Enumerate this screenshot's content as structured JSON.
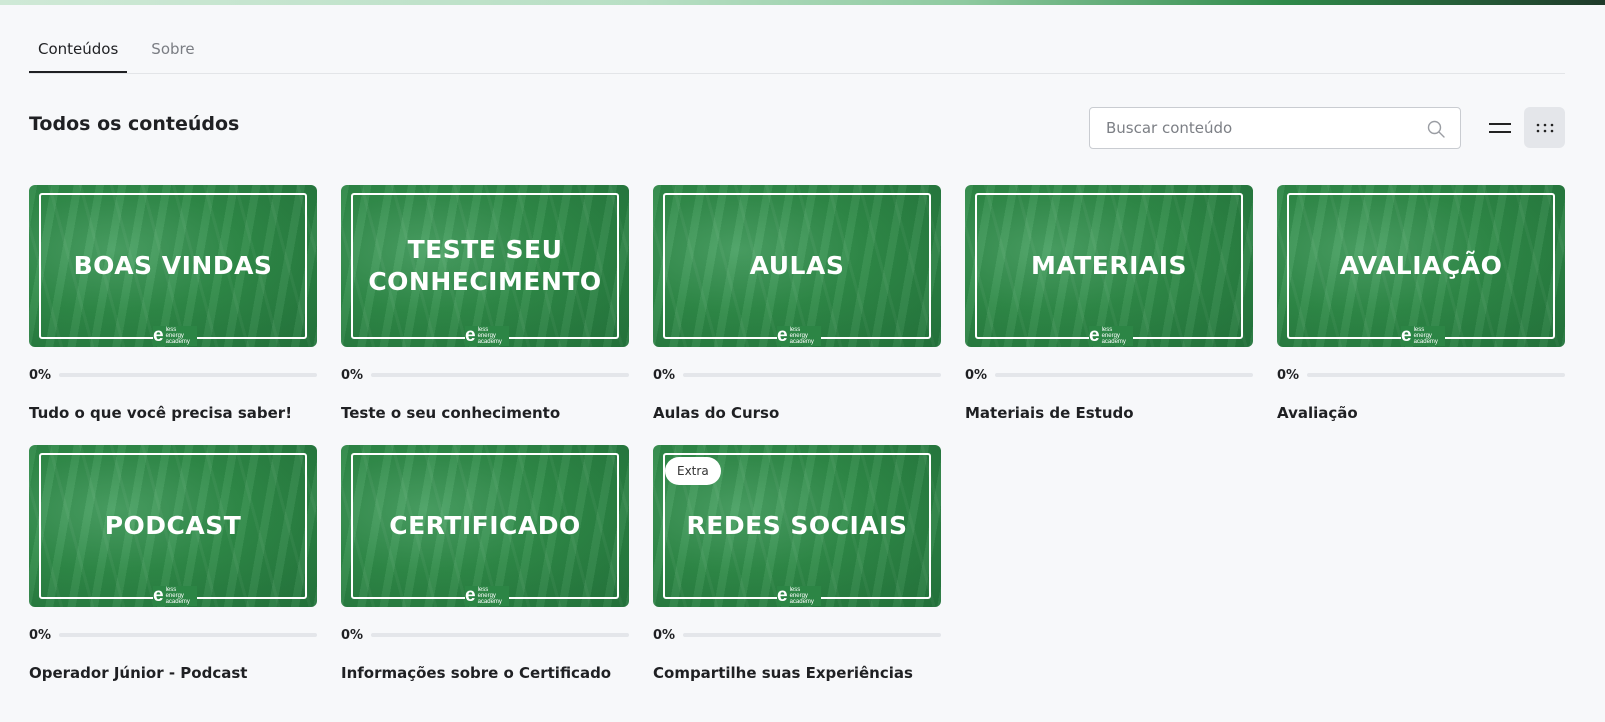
{
  "tabs": [
    {
      "label": "Conteúdos",
      "active": true
    },
    {
      "label": "Sobre",
      "active": false
    }
  ],
  "section_title": "Todos os conteúdos",
  "search": {
    "placeholder": "Buscar conteúdo",
    "value": ""
  },
  "icons": {
    "search": "search-icon",
    "list_view": "list-view-icon",
    "grid_view": "grid-view-icon"
  },
  "colors": {
    "accent_green": "#2f8a48",
    "background": "#f7f8fa"
  },
  "logo": {
    "mark": "e",
    "lines": [
      "less",
      "energy",
      "academy"
    ]
  },
  "cards": [
    {
      "thumb_title": "BOAS VINDAS",
      "progress_label": "0%",
      "progress": 0,
      "title": "Tudo o que você precisa saber!",
      "badge": ""
    },
    {
      "thumb_title": "TESTE SEU CONHECIMENTO",
      "progress_label": "0%",
      "progress": 0,
      "title": "Teste o seu conhecimento",
      "badge": ""
    },
    {
      "thumb_title": "AULAS",
      "progress_label": "0%",
      "progress": 0,
      "title": "Aulas do Curso",
      "badge": ""
    },
    {
      "thumb_title": "MATERIAIS",
      "progress_label": "0%",
      "progress": 0,
      "title": "Materiais de Estudo",
      "badge": ""
    },
    {
      "thumb_title": "AVALIAÇÃO",
      "progress_label": "0%",
      "progress": 0,
      "title": "Avaliação",
      "badge": ""
    },
    {
      "thumb_title": "PODCAST",
      "progress_label": "0%",
      "progress": 0,
      "title": "Operador Júnior - Podcast",
      "badge": ""
    },
    {
      "thumb_title": "CERTIFICADO",
      "progress_label": "0%",
      "progress": 0,
      "title": "Informações sobre o Certificado",
      "badge": ""
    },
    {
      "thumb_title": "REDES SOCIAIS",
      "progress_label": "0%",
      "progress": 0,
      "title": "Compartilhe suas Experiências",
      "badge": "Extra"
    }
  ]
}
